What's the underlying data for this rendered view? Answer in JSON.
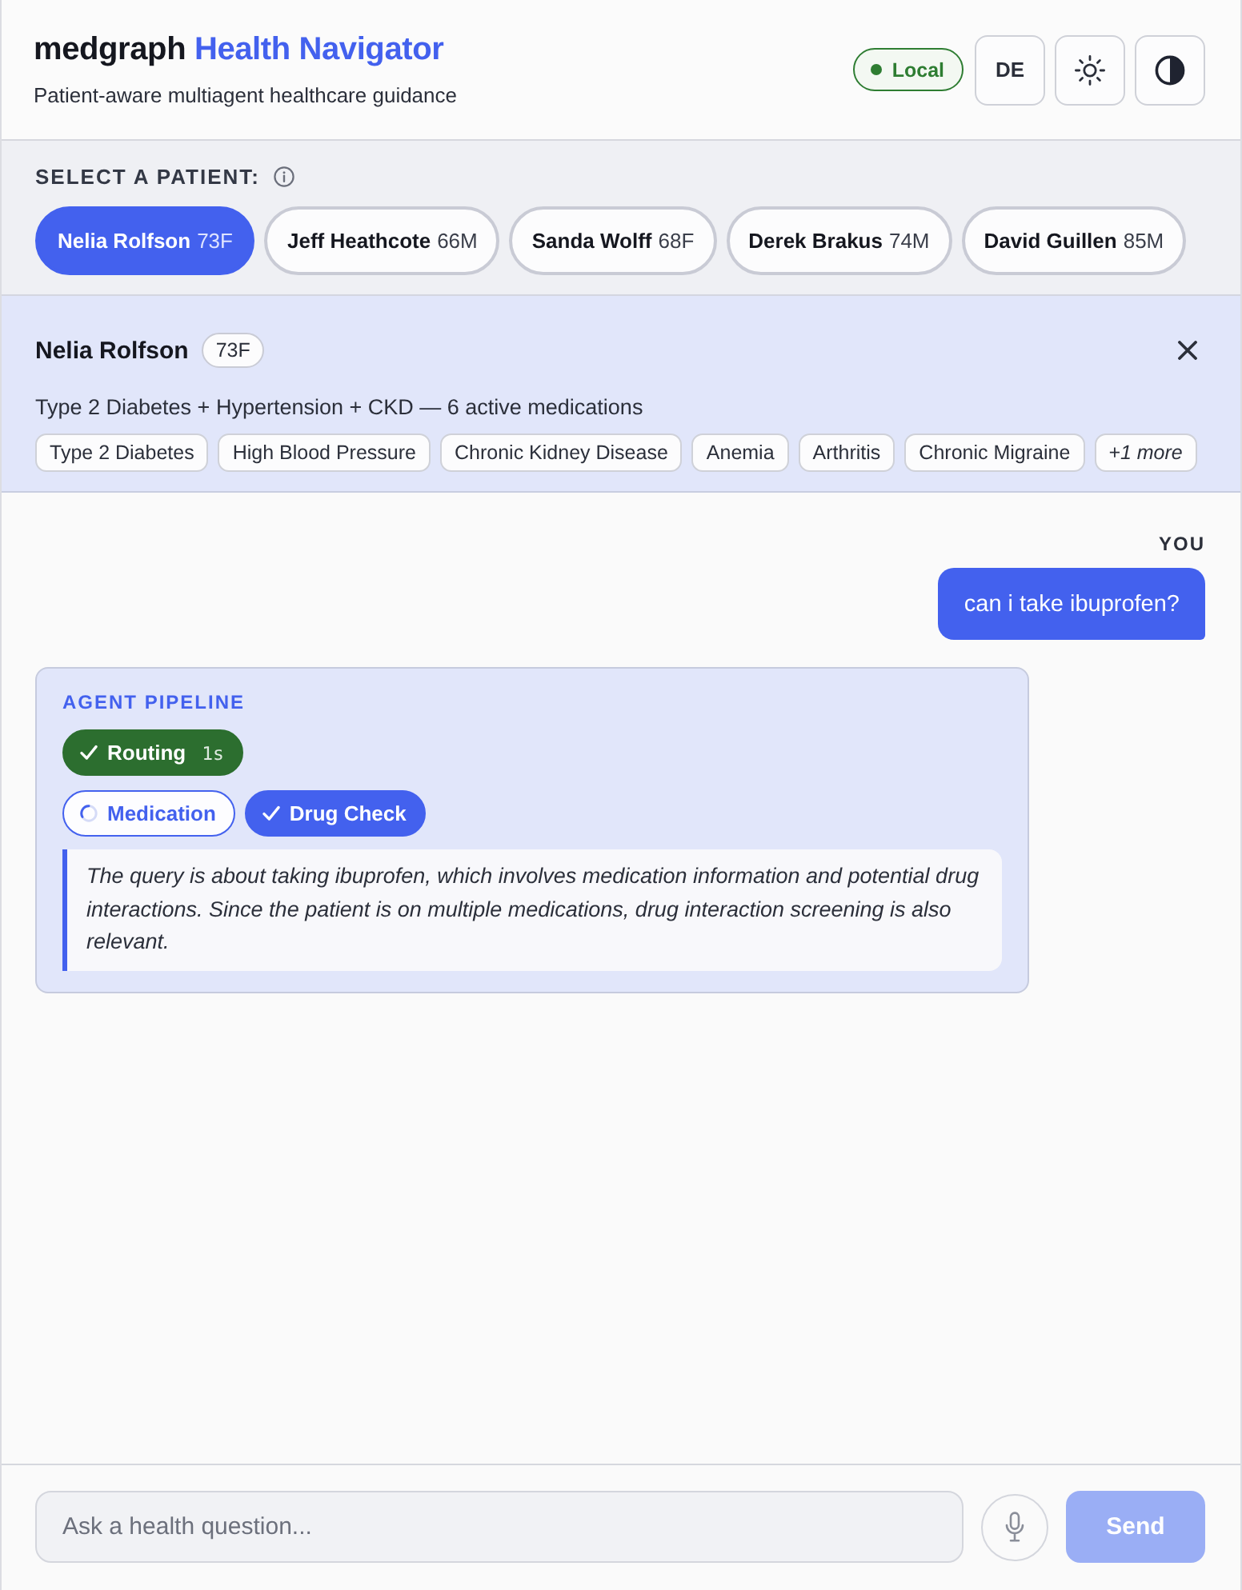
{
  "header": {
    "brand": "medgraph",
    "title": "Health Navigator",
    "subtitle": "Patient-aware multiagent healthcare guidance",
    "mode_badge": "Local",
    "language_button": "DE"
  },
  "patient_picker": {
    "label": "SELECT A PATIENT:",
    "patients": [
      {
        "name": "Nelia Rolfson",
        "age_sex": "73F",
        "selected": true
      },
      {
        "name": "Jeff Heathcote",
        "age_sex": "66M",
        "selected": false
      },
      {
        "name": "Sanda Wolff",
        "age_sex": "68F",
        "selected": false
      },
      {
        "name": "Derek Brakus",
        "age_sex": "74M",
        "selected": false
      },
      {
        "name": "David Guillen",
        "age_sex": "85M",
        "selected": false
      }
    ]
  },
  "patient_card": {
    "name": "Nelia Rolfson",
    "age_sex": "73F",
    "summary": "Type 2 Diabetes + Hypertension + CKD — 6 active medications",
    "conditions": [
      "Type 2 Diabetes",
      "High Blood Pressure",
      "Chronic Kidney Disease",
      "Anemia",
      "Arthritis",
      "Chronic Migraine"
    ],
    "more": "+1 more"
  },
  "chat": {
    "messages": [
      {
        "kind": "user",
        "sender": "YOU",
        "text": "can i take ibuprofen?"
      },
      {
        "kind": "pipeline",
        "title": "AGENT PIPELINE",
        "router": {
          "label": "Routing",
          "time": "1s",
          "done": true,
          "running": false
        },
        "agents": [
          {
            "label": "Medication",
            "done": false,
            "running": true
          },
          {
            "label": "Drug Check",
            "done": true,
            "running": false
          }
        ],
        "reasoning": "The query is about taking ibuprofen, which involves medication information and potential drug interactions. Since the patient is on multiple medications, drug interaction screening is also relevant."
      }
    ]
  },
  "composer": {
    "placeholder": "Ask a health question...",
    "send_button": "Send",
    "send_disabled": true
  }
}
